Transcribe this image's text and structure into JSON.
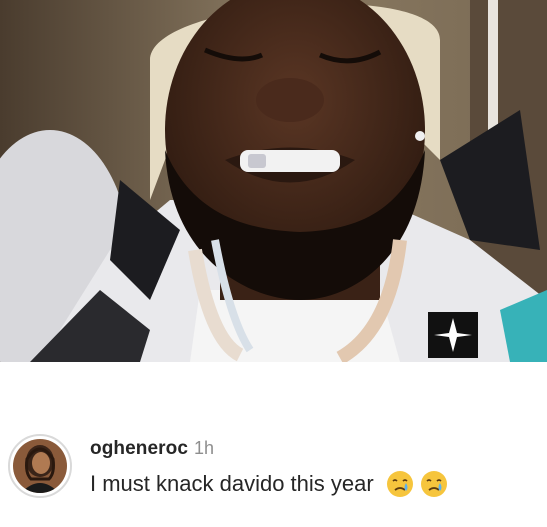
{
  "post": {
    "image_icon": "photo-of-man-wincing-with-grills-and-chains"
  },
  "comment": {
    "username": "ogheneroc",
    "time": "1h",
    "text": "I must knack davido this year",
    "emojis": [
      "crying-face-emoji",
      "crying-face-emoji"
    ]
  },
  "colors": {
    "username": "#262626",
    "time": "#8e8e8e",
    "text": "#262626",
    "background": "#ffffff"
  }
}
